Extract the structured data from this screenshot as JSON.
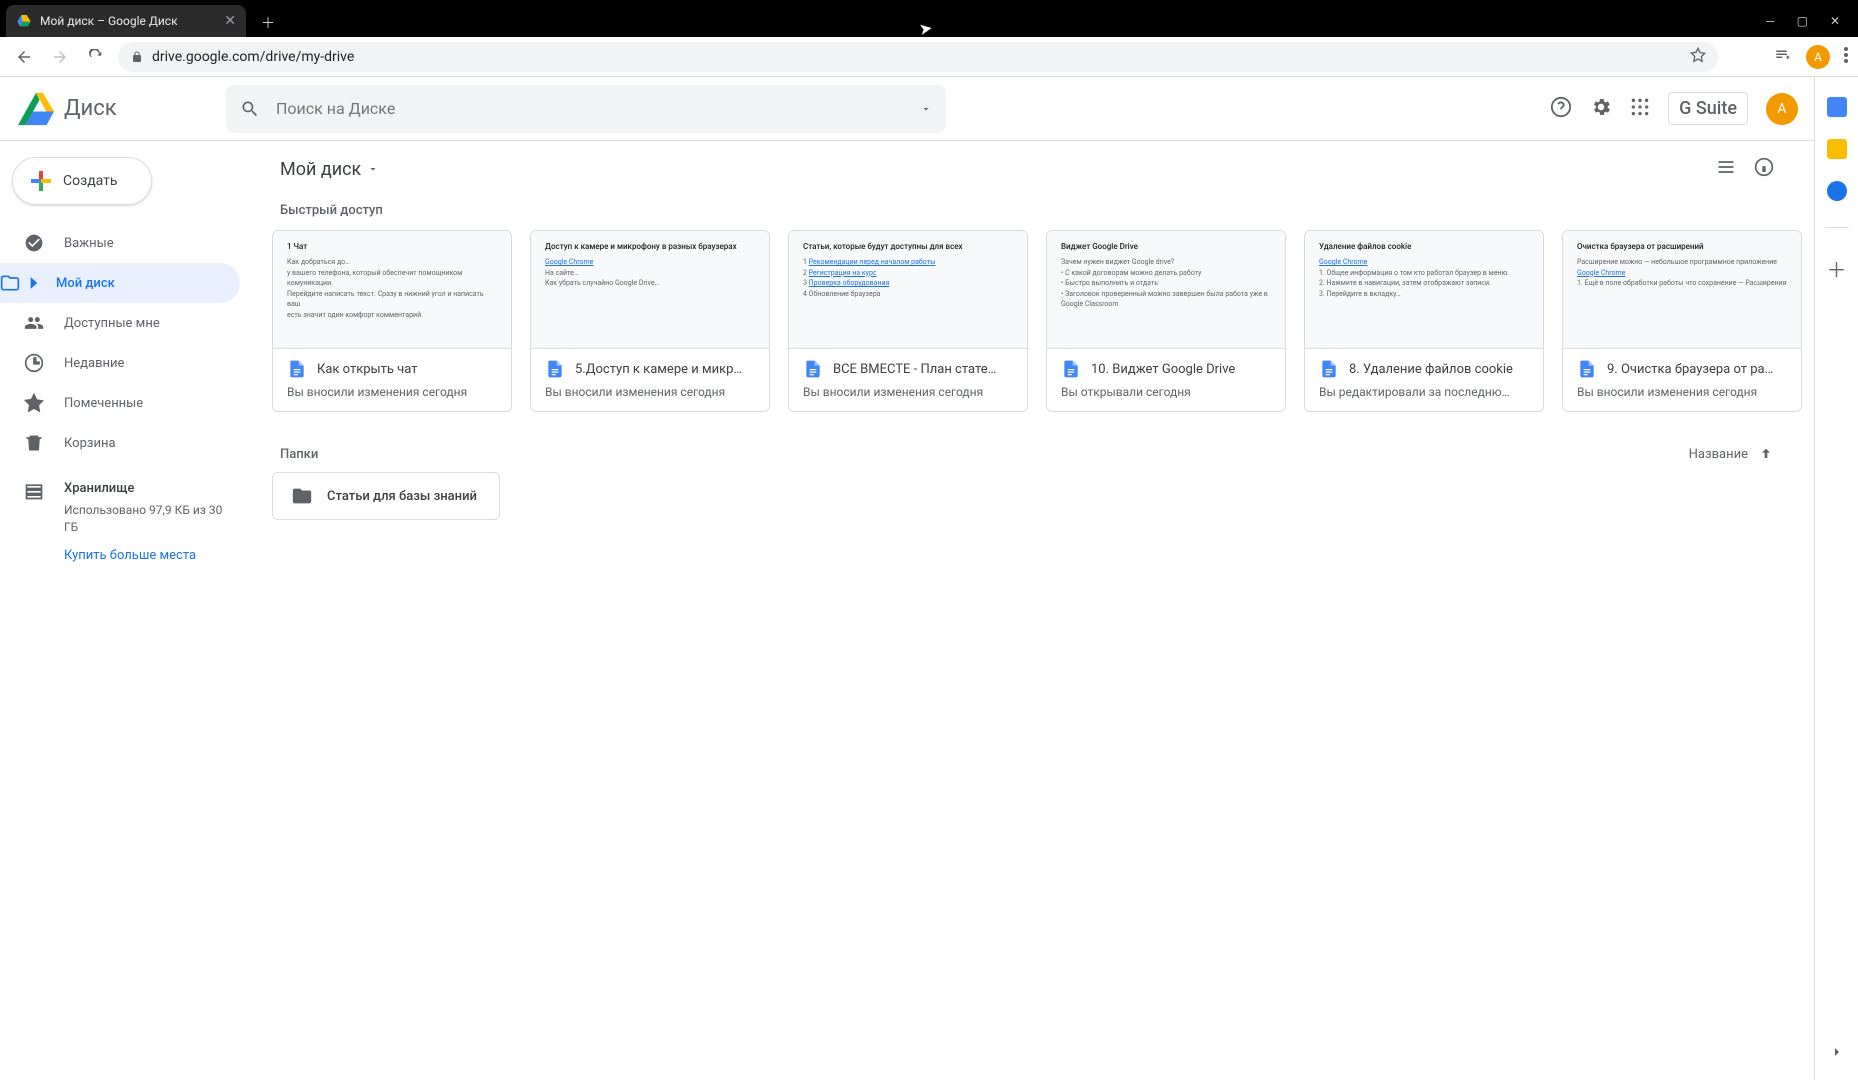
{
  "browser": {
    "tab_title": "Мой диск – Google Диск",
    "url": "drive.google.com/drive/my-drive",
    "avatar_letter": "А"
  },
  "header": {
    "product": "Диск",
    "search_placeholder": "Поиск на Диске",
    "gsuite": "G Suite",
    "avatar_letter": "А"
  },
  "sidebar": {
    "new_button": "Создать",
    "items": [
      {
        "label": "Важные"
      },
      {
        "label": "Мой диск"
      },
      {
        "label": "Доступные мне"
      },
      {
        "label": "Недавние"
      },
      {
        "label": "Помеченные"
      },
      {
        "label": "Корзина"
      }
    ],
    "storage_label": "Хранилище",
    "storage_usage": "Использовано 97,9 КБ из 30 ГБ",
    "buy_more": "Купить больше места"
  },
  "content": {
    "breadcrumb": "Мой диск",
    "quick_title": "Быстрый доступ",
    "quick": [
      {
        "name": "Как открыть чат",
        "meta": "Вы вносили изменения сегодня"
      },
      {
        "name": "5.Доступ к камере и микр…",
        "meta": "Вы вносили изменения сегодня"
      },
      {
        "name": "ВСЕ ВМЕСТЕ - План стате…",
        "meta": "Вы вносили изменения сегодня"
      },
      {
        "name": "10. Виджет Google Drive",
        "meta": "Вы открывали сегодня"
      },
      {
        "name": "8. Удаление файлов cookie",
        "meta": "Вы редактировали за последню…"
      },
      {
        "name": "9. Очистка браузера от ра…",
        "meta": "Вы вносили изменения сегодня"
      }
    ],
    "folders_title": "Папки",
    "sort_label": "Название",
    "folders": [
      {
        "name": "Статьи для базы знаний"
      }
    ]
  },
  "thumbs": [
    {
      "title": "1 Чат",
      "body": "Как добраться до…<br>у вашего телефона, который обеспечит помощником комуникации.<br>Перейдите написать текст. Сразу в нижний угол и написать ваш<br>есть значит один комфорт комментарий."
    },
    {
      "title": "Доступ к камере и микрофону в разных браузерах",
      "body": "<span class='th-link'>Google Chrome</span><br>На сайте…<br>Как убрать случайно Google Drive…"
    },
    {
      "title": "Статьи, которые будут доступны для всех",
      "body": "1 <span class='th-link'>Рекомендации перед началом работы</span><br>2 <span class='th-link'>Регистрация на курс</span><br>3 <span class='th-link'>Проверка оборудования</span><br>4 Обновление браузера"
    },
    {
      "title": "Виджет Google Drive",
      "body": "Зачем нужен виджет Google drive?<br>&bull; С какой договорам можно делать работу<br>&bull; Быстро выполнить и отдать<br>&bull; Заголовок проверенный можно завершен была работа уже в Google Classroom"
    },
    {
      "title": "Удаление файлов cookie",
      "body": "<span class='th-link'>Google Chrome</span><br>1. Общее информация о том кто работал браузер в меню.<br>2. Нажмите в навигации, затем отображают записи.<br>3. Перейдите в вкладку…"
    },
    {
      "title": "Очистка браузера от расширений",
      "body": "Расширение можно — небольшое программное приложение<br><span class='th-link'>Google Chrome</span><br>1. Ещё в поле обработки работы что сохранение — Расширения"
    }
  ]
}
